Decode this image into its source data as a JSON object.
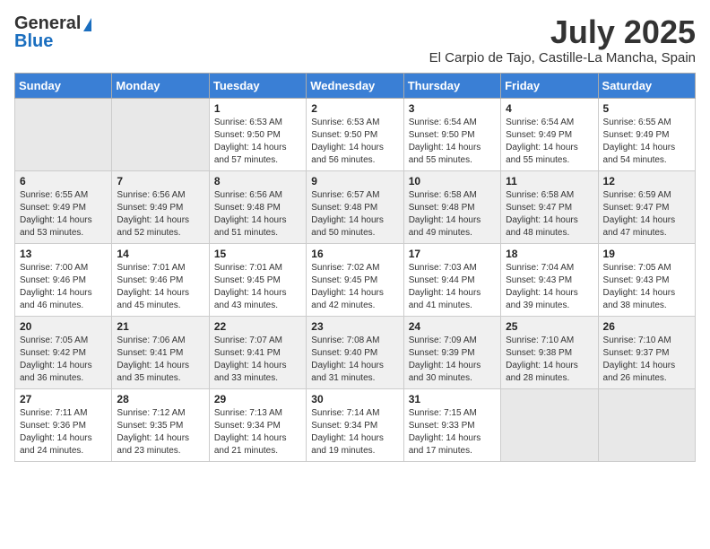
{
  "header": {
    "logo_general": "General",
    "logo_blue": "Blue",
    "month": "July 2025",
    "location": "El Carpio de Tajo, Castille-La Mancha, Spain"
  },
  "days_of_week": [
    "Sunday",
    "Monday",
    "Tuesday",
    "Wednesday",
    "Thursday",
    "Friday",
    "Saturday"
  ],
  "weeks": [
    [
      {
        "day": "",
        "info": ""
      },
      {
        "day": "",
        "info": ""
      },
      {
        "day": "1",
        "info": "Sunrise: 6:53 AM\nSunset: 9:50 PM\nDaylight: 14 hours and 57 minutes."
      },
      {
        "day": "2",
        "info": "Sunrise: 6:53 AM\nSunset: 9:50 PM\nDaylight: 14 hours and 56 minutes."
      },
      {
        "day": "3",
        "info": "Sunrise: 6:54 AM\nSunset: 9:50 PM\nDaylight: 14 hours and 55 minutes."
      },
      {
        "day": "4",
        "info": "Sunrise: 6:54 AM\nSunset: 9:49 PM\nDaylight: 14 hours and 55 minutes."
      },
      {
        "day": "5",
        "info": "Sunrise: 6:55 AM\nSunset: 9:49 PM\nDaylight: 14 hours and 54 minutes."
      }
    ],
    [
      {
        "day": "6",
        "info": "Sunrise: 6:55 AM\nSunset: 9:49 PM\nDaylight: 14 hours and 53 minutes."
      },
      {
        "day": "7",
        "info": "Sunrise: 6:56 AM\nSunset: 9:49 PM\nDaylight: 14 hours and 52 minutes."
      },
      {
        "day": "8",
        "info": "Sunrise: 6:56 AM\nSunset: 9:48 PM\nDaylight: 14 hours and 51 minutes."
      },
      {
        "day": "9",
        "info": "Sunrise: 6:57 AM\nSunset: 9:48 PM\nDaylight: 14 hours and 50 minutes."
      },
      {
        "day": "10",
        "info": "Sunrise: 6:58 AM\nSunset: 9:48 PM\nDaylight: 14 hours and 49 minutes."
      },
      {
        "day": "11",
        "info": "Sunrise: 6:58 AM\nSunset: 9:47 PM\nDaylight: 14 hours and 48 minutes."
      },
      {
        "day": "12",
        "info": "Sunrise: 6:59 AM\nSunset: 9:47 PM\nDaylight: 14 hours and 47 minutes."
      }
    ],
    [
      {
        "day": "13",
        "info": "Sunrise: 7:00 AM\nSunset: 9:46 PM\nDaylight: 14 hours and 46 minutes."
      },
      {
        "day": "14",
        "info": "Sunrise: 7:01 AM\nSunset: 9:46 PM\nDaylight: 14 hours and 45 minutes."
      },
      {
        "day": "15",
        "info": "Sunrise: 7:01 AM\nSunset: 9:45 PM\nDaylight: 14 hours and 43 minutes."
      },
      {
        "day": "16",
        "info": "Sunrise: 7:02 AM\nSunset: 9:45 PM\nDaylight: 14 hours and 42 minutes."
      },
      {
        "day": "17",
        "info": "Sunrise: 7:03 AM\nSunset: 9:44 PM\nDaylight: 14 hours and 41 minutes."
      },
      {
        "day": "18",
        "info": "Sunrise: 7:04 AM\nSunset: 9:43 PM\nDaylight: 14 hours and 39 minutes."
      },
      {
        "day": "19",
        "info": "Sunrise: 7:05 AM\nSunset: 9:43 PM\nDaylight: 14 hours and 38 minutes."
      }
    ],
    [
      {
        "day": "20",
        "info": "Sunrise: 7:05 AM\nSunset: 9:42 PM\nDaylight: 14 hours and 36 minutes."
      },
      {
        "day": "21",
        "info": "Sunrise: 7:06 AM\nSunset: 9:41 PM\nDaylight: 14 hours and 35 minutes."
      },
      {
        "day": "22",
        "info": "Sunrise: 7:07 AM\nSunset: 9:41 PM\nDaylight: 14 hours and 33 minutes."
      },
      {
        "day": "23",
        "info": "Sunrise: 7:08 AM\nSunset: 9:40 PM\nDaylight: 14 hours and 31 minutes."
      },
      {
        "day": "24",
        "info": "Sunrise: 7:09 AM\nSunset: 9:39 PM\nDaylight: 14 hours and 30 minutes."
      },
      {
        "day": "25",
        "info": "Sunrise: 7:10 AM\nSunset: 9:38 PM\nDaylight: 14 hours and 28 minutes."
      },
      {
        "day": "26",
        "info": "Sunrise: 7:10 AM\nSunset: 9:37 PM\nDaylight: 14 hours and 26 minutes."
      }
    ],
    [
      {
        "day": "27",
        "info": "Sunrise: 7:11 AM\nSunset: 9:36 PM\nDaylight: 14 hours and 24 minutes."
      },
      {
        "day": "28",
        "info": "Sunrise: 7:12 AM\nSunset: 9:35 PM\nDaylight: 14 hours and 23 minutes."
      },
      {
        "day": "29",
        "info": "Sunrise: 7:13 AM\nSunset: 9:34 PM\nDaylight: 14 hours and 21 minutes."
      },
      {
        "day": "30",
        "info": "Sunrise: 7:14 AM\nSunset: 9:34 PM\nDaylight: 14 hours and 19 minutes."
      },
      {
        "day": "31",
        "info": "Sunrise: 7:15 AM\nSunset: 9:33 PM\nDaylight: 14 hours and 17 minutes."
      },
      {
        "day": "",
        "info": ""
      },
      {
        "day": "",
        "info": ""
      }
    ]
  ]
}
